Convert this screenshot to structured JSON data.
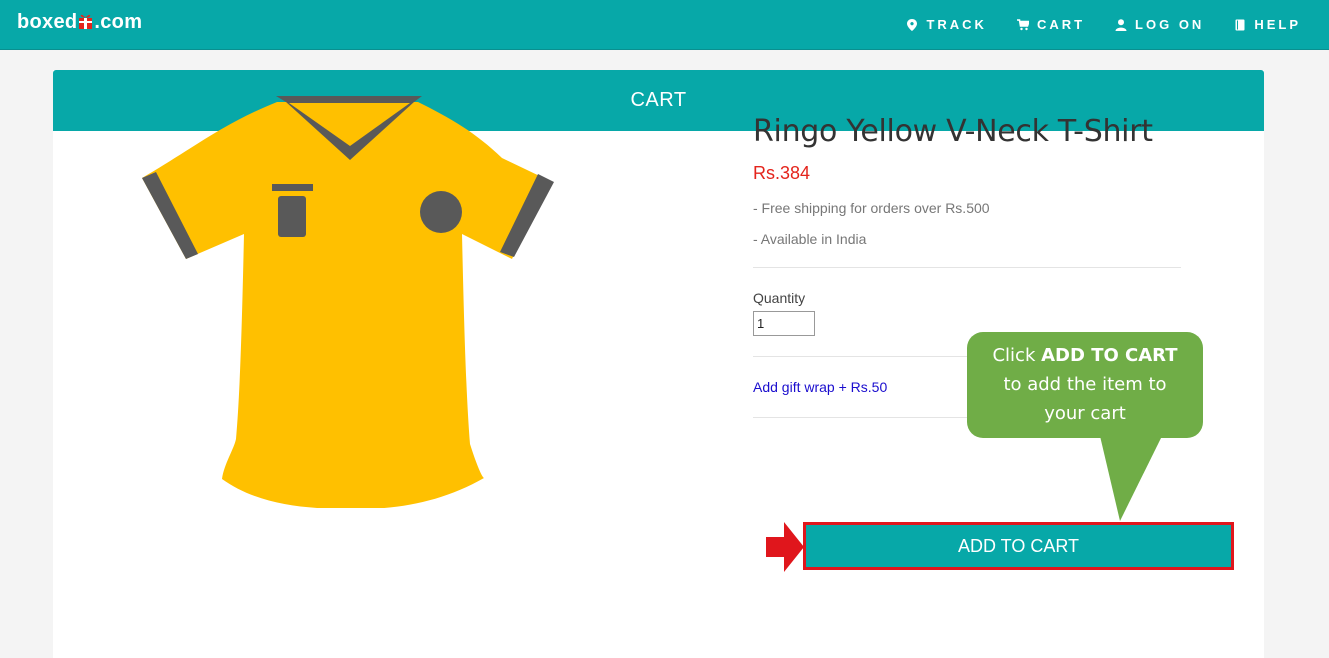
{
  "header": {
    "logo_left": "boxed",
    "logo_right": ".com",
    "nav": [
      {
        "label": "TRACK",
        "icon": "map-marker-icon"
      },
      {
        "label": "CART",
        "icon": "cart-icon"
      },
      {
        "label": "LOG ON",
        "icon": "user-icon"
      },
      {
        "label": "HELP",
        "icon": "book-icon"
      }
    ]
  },
  "page": {
    "heading": "CART"
  },
  "product": {
    "name": "Ringo Yellow V-Neck T-Shirt",
    "price": "Rs.384",
    "features": [
      "- Free shipping for orders over Rs.500",
      "- Available in India"
    ],
    "quantity_label": "Quantity",
    "quantity_value": "1",
    "gift_wrap": "Add gift wrap + Rs.50",
    "add_button": "ADD TO CART",
    "shirt_color": "#ffc000",
    "trim_color": "#595959"
  },
  "callout": {
    "line1_prefix": "Click ",
    "line1_bold": "ADD TO CART",
    "line2": "to add the item to",
    "line3": "your cart"
  },
  "colors": {
    "brand": "#07a8a8",
    "price": "#e4241c",
    "callout": "#70ad47",
    "highlight": "#e0161c"
  }
}
